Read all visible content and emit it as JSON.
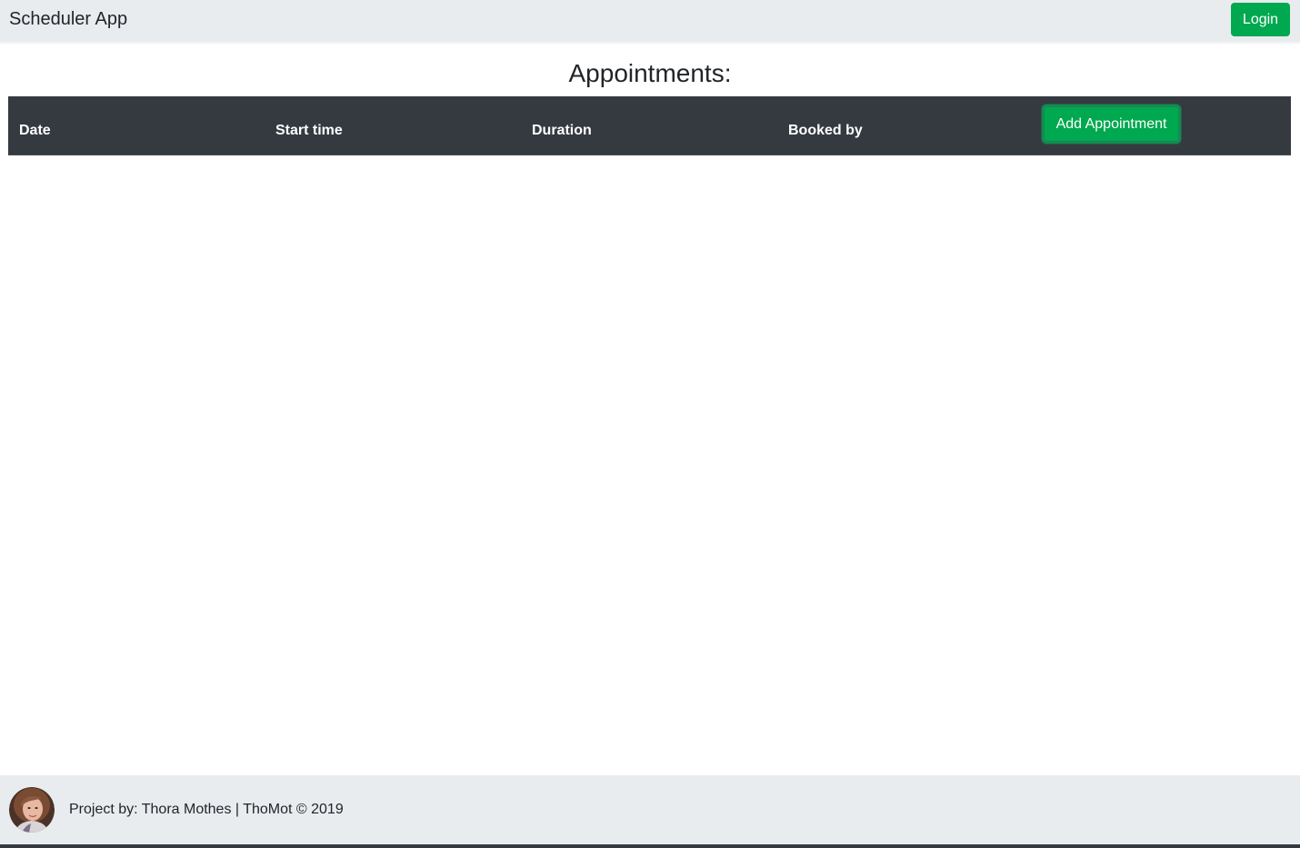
{
  "navbar": {
    "brand": "Scheduler App",
    "login_label": "Login"
  },
  "main": {
    "title": "Appointments:",
    "table": {
      "columns": [
        "Date",
        "Start time",
        "Duration",
        "Booked by"
      ],
      "add_button_label": "Add Appointment",
      "rows": []
    }
  },
  "footer": {
    "avatar_icon": "profile-photo",
    "text": "Project by: Thora Mothes | ThoMot © 2019"
  },
  "colors": {
    "navbar_bg": "#e9ecef",
    "table_header_bg": "#343a40",
    "button_green": "#00a84f",
    "footer_bg": "#e9ecef"
  }
}
